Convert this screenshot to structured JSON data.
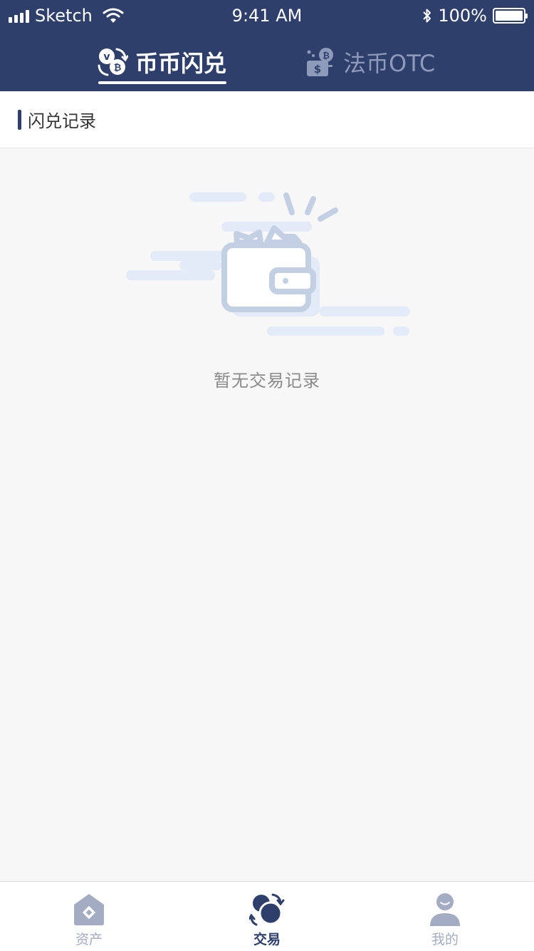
{
  "status_bar": {
    "carrier": "Sketch",
    "time": "9:41 AM",
    "battery": "100%"
  },
  "tabs": {
    "flash": "币币闪兑",
    "otc": "法币OTC"
  },
  "section": {
    "title": "闪兑记录"
  },
  "empty_state": {
    "text": "暂无交易记录"
  },
  "tabbar": {
    "assets": "资产",
    "trade": "交易",
    "mine": "我的",
    "active": "trade"
  },
  "colors": {
    "header_bg": "#2f3f6b",
    "active": "#2f3f6b",
    "inactive": "#a3acc2",
    "illustration": "#c3d0e4",
    "cloud": "#e3ebf8"
  },
  "icons": {
    "flash": "coin-swap-icon",
    "otc": "cash-coin-icon",
    "assets": "home-diamond-icon",
    "trade": "circles-swap-icon",
    "mine": "user-icon",
    "empty": "wallet-illustration"
  }
}
